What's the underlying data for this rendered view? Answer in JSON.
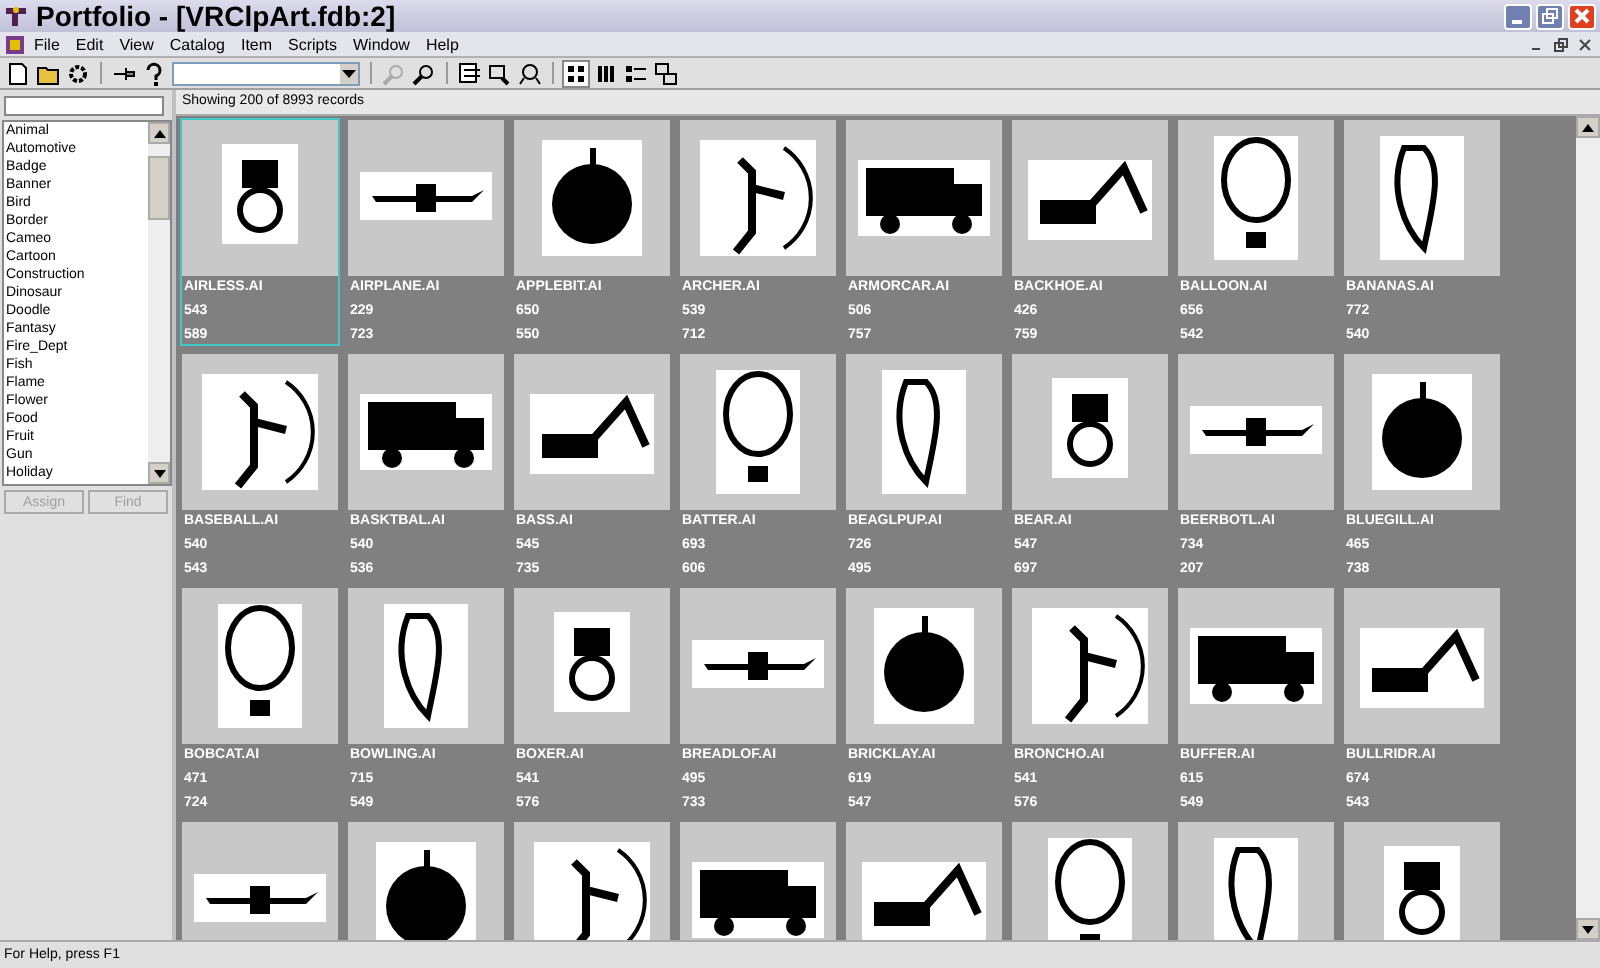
{
  "window": {
    "title": "Portfolio - [VRClpArt.fdb:2]"
  },
  "menu": [
    "File",
    "Edit",
    "View",
    "Catalog",
    "Item",
    "Scripts",
    "Window",
    "Help"
  ],
  "sidebar": {
    "items": [
      {
        "label": "Animal",
        "selected": false
      },
      {
        "label": "Automotive",
        "selected": false
      },
      {
        "label": "Badge",
        "selected": false
      },
      {
        "label": "Banner",
        "selected": false
      },
      {
        "label": "Bird",
        "selected": false
      },
      {
        "label": "Border",
        "selected": false
      },
      {
        "label": "Cameo",
        "selected": false
      },
      {
        "label": "Cartoon",
        "selected": false
      },
      {
        "label": "Construction",
        "selected": false
      },
      {
        "label": "Dinosaur",
        "selected": false
      },
      {
        "label": "Doodle",
        "selected": false
      },
      {
        "label": "Fantasy",
        "selected": false
      },
      {
        "label": "Fire_Dept",
        "selected": false
      },
      {
        "label": "Fish",
        "selected": false
      },
      {
        "label": "Flame",
        "selected": false
      },
      {
        "label": "Flower",
        "selected": false
      },
      {
        "label": "Food",
        "selected": false
      },
      {
        "label": "Fruit",
        "selected": false
      },
      {
        "label": "Gun",
        "selected": false
      },
      {
        "label": "Holiday",
        "selected": false
      }
    ],
    "buttons": [
      {
        "label": "Assign",
        "disabled": true
      },
      {
        "label": "Find",
        "disabled": true
      }
    ]
  },
  "records_header": "Showing 200 of 8993 records",
  "gallery": [
    {
      "name": "AIRLESS.AI",
      "number_1": "543",
      "number_2": "589",
      "selected": true
    },
    {
      "name": "AIRPLANE.AI",
      "number_1": "229",
      "number_2": "723",
      "selected": false
    },
    {
      "name": "APPLEBIT.AI",
      "number_1": "650",
      "number_2": "550",
      "selected": false
    },
    {
      "name": "ARCHER.AI",
      "number_1": "539",
      "number_2": "712",
      "selected": false
    },
    {
      "name": "ARMORCAR.AI",
      "number_1": "506",
      "number_2": "757",
      "selected": false
    },
    {
      "name": "BACKHOE.AI",
      "number_1": "426",
      "number_2": "759",
      "selected": false
    },
    {
      "name": "BALLOON.AI",
      "number_1": "656",
      "number_2": "542",
      "selected": false
    },
    {
      "name": "BANANAS.AI",
      "number_1": "772",
      "number_2": "540",
      "selected": false
    },
    {
      "name": "BASEBALL.AI",
      "number_1": "540",
      "number_2": "543",
      "selected": false
    },
    {
      "name": "BASKTBAL.AI",
      "number_1": "540",
      "number_2": "536",
      "selected": false
    },
    {
      "name": "BASS.AI",
      "number_1": "545",
      "number_2": "735",
      "selected": false
    },
    {
      "name": "BATTER.AI",
      "number_1": "693",
      "number_2": "606",
      "selected": false
    },
    {
      "name": "BEAGLPUP.AI",
      "number_1": "726",
      "number_2": "495",
      "selected": false
    },
    {
      "name": "BEAR.AI",
      "number_1": "547",
      "number_2": "697",
      "selected": false
    },
    {
      "name": "BEERBOTL.AI",
      "number_1": "734",
      "number_2": "207",
      "selected": false
    },
    {
      "name": "BLUEGILL.AI",
      "number_1": "465",
      "number_2": "738",
      "selected": false
    },
    {
      "name": "BOBCAT.AI",
      "number_1": "471",
      "number_2": "724",
      "selected": false
    },
    {
      "name": "BOWLING.AI",
      "number_1": "715",
      "number_2": "549",
      "selected": false
    },
    {
      "name": "BOXER.AI",
      "number_1": "541",
      "number_2": "576",
      "selected": false
    },
    {
      "name": "BREADLOF.AI",
      "number_1": "495",
      "number_2": "733",
      "selected": false
    },
    {
      "name": "BRICKLAY.AI",
      "number_1": "619",
      "number_2": "547",
      "selected": false
    },
    {
      "name": "BRONCHO.AI",
      "number_1": "541",
      "number_2": "576",
      "selected": false
    },
    {
      "name": "BUFFER.AI",
      "number_1": "615",
      "number_2": "549",
      "selected": false
    },
    {
      "name": "BULLRIDR.AI",
      "number_1": "674",
      "number_2": "543",
      "selected": false
    },
    {
      "selected": false
    },
    {
      "selected": false
    },
    {
      "selected": false
    },
    {
      "selected": false
    },
    {
      "selected": false
    },
    {
      "selected": false
    },
    {
      "selected": false
    },
    {
      "selected": false
    }
  ],
  "status_bar": "For Help, press F1"
}
